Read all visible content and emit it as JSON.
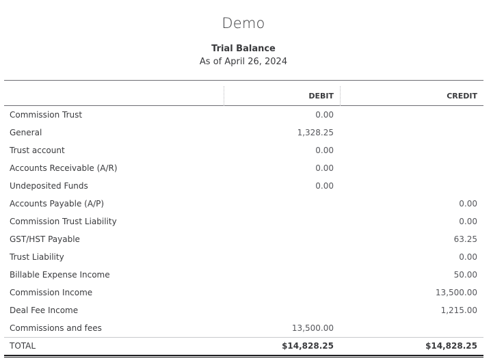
{
  "report": {
    "company": "Demo",
    "title": "Trial Balance",
    "date": "As of April 26, 2024"
  },
  "columns": {
    "account": "",
    "debit": "DEBIT",
    "credit": "CREDIT"
  },
  "rows": [
    {
      "account": "Commission Trust",
      "debit": "0.00",
      "credit": ""
    },
    {
      "account": "General",
      "debit": "1,328.25",
      "credit": ""
    },
    {
      "account": "Trust account",
      "debit": "0.00",
      "credit": ""
    },
    {
      "account": "Accounts Receivable (A/R)",
      "debit": "0.00",
      "credit": ""
    },
    {
      "account": "Undeposited Funds",
      "debit": "0.00",
      "credit": ""
    },
    {
      "account": "Accounts Payable (A/P)",
      "debit": "",
      "credit": "0.00"
    },
    {
      "account": "Commission Trust Liability",
      "debit": "",
      "credit": "0.00"
    },
    {
      "account": "GST/HST Payable",
      "debit": "",
      "credit": "63.25"
    },
    {
      "account": "Trust Liability",
      "debit": "",
      "credit": "0.00"
    },
    {
      "account": "Billable Expense Income",
      "debit": "",
      "credit": "50.00"
    },
    {
      "account": "Commission Income",
      "debit": "",
      "credit": "13,500.00"
    },
    {
      "account": "Deal Fee Income",
      "debit": "",
      "credit": "1,215.00"
    },
    {
      "account": "Commissions and fees",
      "debit": "13,500.00",
      "credit": ""
    }
  ],
  "total": {
    "label": "TOTAL",
    "debit": "$14,828.25",
    "credit": "$14,828.25"
  }
}
